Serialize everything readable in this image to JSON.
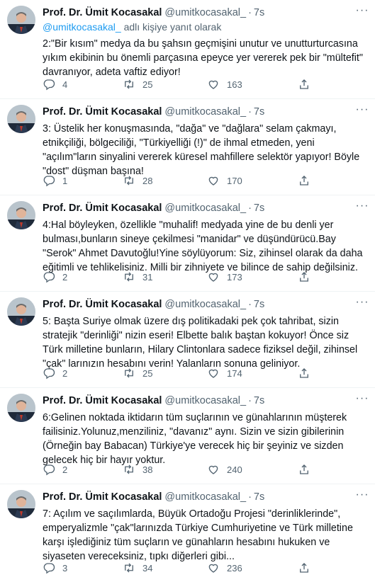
{
  "colors": {
    "text": "#0f1419",
    "secondary": "#536471",
    "accent": "#1d9bf0",
    "divider": "#eff3f4"
  },
  "icons": [
    "more-icon",
    "reply-icon",
    "retweet-icon",
    "like-icon",
    "share-icon"
  ],
  "tweets": [
    {
      "name": "Prof. Dr. Ümit Kocasakal",
      "handle": "@umitkocasakal_",
      "dot": "·",
      "time": "7s",
      "replying_mention": "@umitkocasakal_",
      "replying_suffix": " adlı kişiye yanıt olarak",
      "text": "2:\"Bir kısım\" medya da bu şahsın geçmişini unutur ve unutturturcasına  yıkım ekibinin bu önemli parçasına epeyce yer vererek pek bir \"mültefit\" davranıyor, adeta vaftiz ediyor!",
      "replies": "4",
      "retweets": "25",
      "likes": "163"
    },
    {
      "name": "Prof. Dr. Ümit Kocasakal",
      "handle": "@umitkocasakal_",
      "dot": "·",
      "time": "7s",
      "text": "3: Üstelik her konuşmasında, \"dağa\" ve \"dağlara\" selam çakmayı, etnikçiliği, bölgeciliği, \"Türkiyelliği (!)\" de ihmal etmeden, yeni \"açılım\"ların sinyalini vererek küresel mahfillere selektör yapıyor! Böyle \"dost\" düşman başına!",
      "replies": "1",
      "retweets": "28",
      "likes": "170"
    },
    {
      "name": "Prof. Dr. Ümit Kocasakal",
      "handle": "@umitkocasakal_",
      "dot": "·",
      "time": "7s",
      "text": "4:Hal böyleyken, özellikle \"muhalif! medyada  yine de bu denli yer bulması,bunların sineye çekilmesi \"manidar\" ve düşündürücü.Bay \"Serok\" Ahmet Davutoğlu!Yine söylüyorum: Siz, zihinsel olarak da daha eğitimli ve tehlikelisiniz. Milli bir zihniyete ve bilince de sahip değilsiniz.",
      "replies": "2",
      "retweets": "31",
      "likes": "173"
    },
    {
      "name": "Prof. Dr. Ümit Kocasakal",
      "handle": "@umitkocasakal_",
      "dot": "·",
      "time": "7s",
      "text": "5: Başta Suriye olmak üzere dış politikadaki pek çok tahribat, sizin stratejik \"derinliği\" nizin eseri! Elbette balık baştan kokuyor! Önce siz Türk milletine bunların, Hilary Clintonlara sadece fiziksel değil, zihinsel \"çak\" larınızın hesabını verin! Yalanların sonuna geliniyor.",
      "replies": "2",
      "retweets": "25",
      "likes": "174"
    },
    {
      "name": "Prof. Dr. Ümit Kocasakal",
      "handle": "@umitkocasakal_",
      "dot": "·",
      "time": "7s",
      "text": "6:Gelinen noktada iktidarın tüm suçlarının ve günahlarının müşterek failisiniz.Yolunuz,menziliniz, \"davanız\" aynı. Sizin ve sizin gibilerinin (Örneğin bay Babacan) Türkiye'ye verecek hiç bir şeyiniz ve sizden gelecek hiç bir hayır yoktur.",
      "replies": "2",
      "retweets": "38",
      "likes": "240"
    },
    {
      "name": "Prof. Dr. Ümit Kocasakal",
      "handle": "@umitkocasakal_",
      "dot": "·",
      "time": "7s",
      "text": "7: Açılım ve saçılımlarda, Büyük Ortadoğu Projesi \"derinliklerinde\", emperyalizmle \"çak\"larınızda Türkiye Cumhuriyetine ve Türk milletine karşı işlediğiniz tüm suçların ve günahların hesabını hukuken ve siyaseten vereceksiniz, tıpkı diğerleri gibi...",
      "replies": "3",
      "retweets": "34",
      "likes": "236"
    }
  ]
}
